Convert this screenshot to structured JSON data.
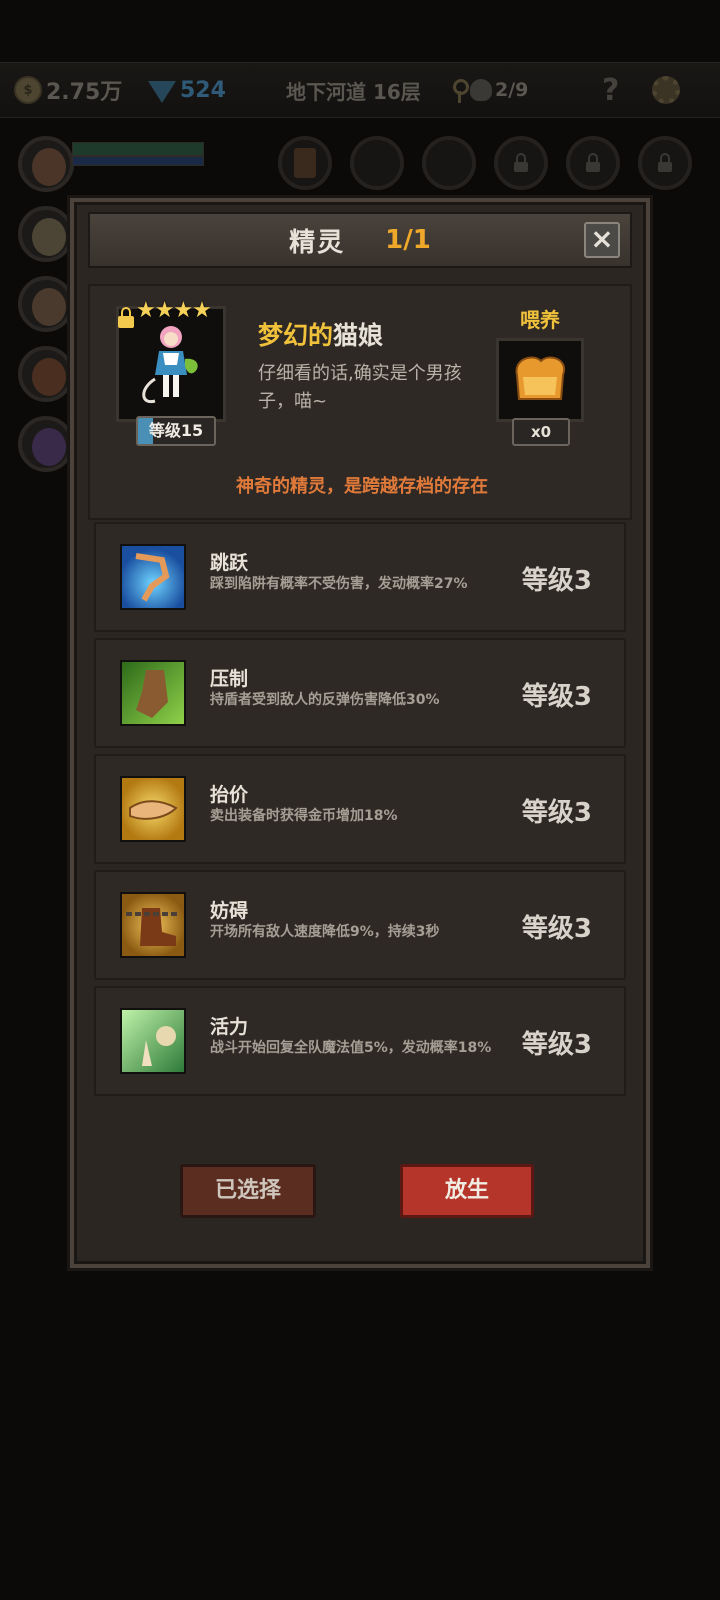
{
  "hud": {
    "gold": "2.75万",
    "gems": "524",
    "location": "地下河道 16层",
    "kills": "2/9",
    "help": "?"
  },
  "dialog": {
    "title": "精灵",
    "count": "1/1",
    "close": "×"
  },
  "pet": {
    "stars": "★★★★",
    "level_label": "等级15",
    "name_prefix": "梦幻的",
    "name_suffix": "猫娘",
    "description": "仔细看的话,确实是个男孩子，喵~",
    "feed_label": "喂养",
    "feed_count": "x0",
    "note": "神奇的精灵，是跨越存档的存在"
  },
  "skills": [
    {
      "name": "跳跃",
      "desc": "踩到陷阱有概率不受伤害，发动概率27%",
      "level": "等级3"
    },
    {
      "name": "压制",
      "desc": "持盾者受到敌人的反弹伤害降低30%",
      "level": "等级3"
    },
    {
      "name": "抬价",
      "desc": "卖出装备时获得金币增加18%",
      "level": "等级3"
    },
    {
      "name": "妨碍",
      "desc": "开场所有敌人速度降低9%，持续3秒",
      "level": "等级3"
    },
    {
      "name": "活力",
      "desc": "战斗开始回复全队魔法值5%，发动概率18%",
      "level": "等级3"
    }
  ],
  "buttons": {
    "selected": "已选择",
    "release": "放生"
  }
}
